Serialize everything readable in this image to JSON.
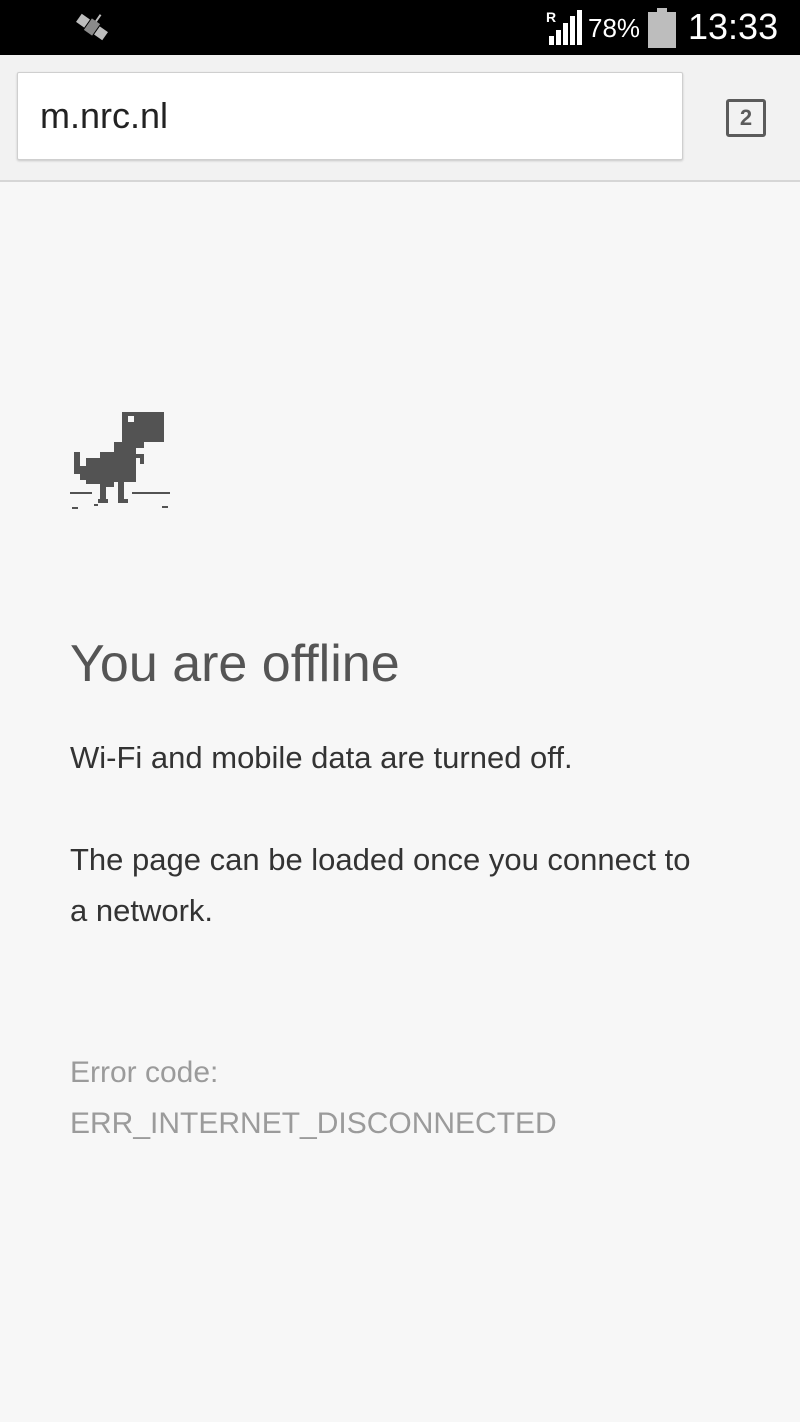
{
  "status_bar": {
    "roaming_indicator": "R",
    "battery_percent": "78%",
    "time": "13:33",
    "icons": [
      "satellite-icon",
      "signal-icon",
      "battery-icon"
    ]
  },
  "toolbar": {
    "url": "m.nrc.nl",
    "tab_count": "2"
  },
  "error_page": {
    "icon": "offline-dino-icon",
    "title": "You are offline",
    "message_1": "Wi-Fi and mobile data are turned off.",
    "message_2": "The page can be loaded once you connect to a network.",
    "error_label": "Error code:",
    "error_code": "ERR_INTERNET_DISCONNECTED"
  },
  "colors": {
    "status_bar_bg": "#000000",
    "page_bg": "#f7f7f7",
    "title_text": "#555555",
    "body_text": "#333333",
    "muted_text": "#9b9b9b"
  }
}
